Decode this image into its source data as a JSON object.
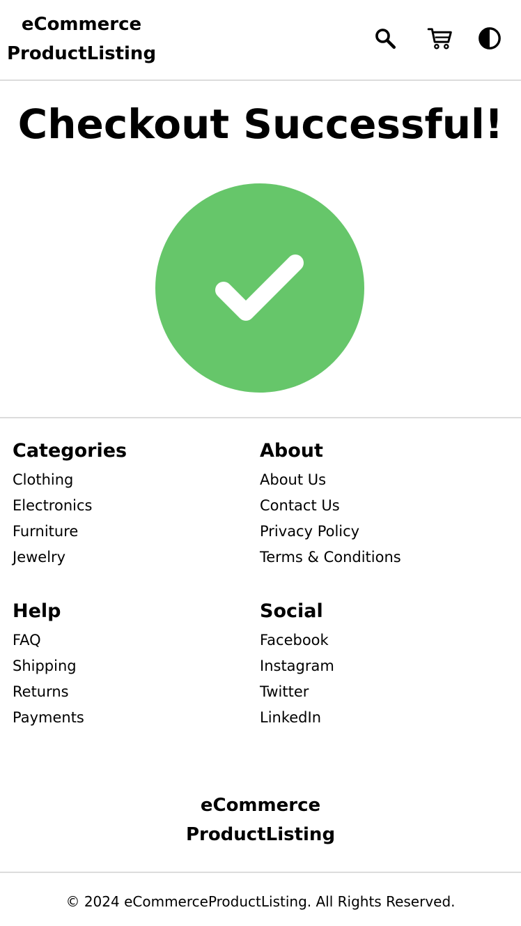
{
  "header": {
    "brand_line1": "eCommerce",
    "brand_line2": "ProductListing",
    "icons": [
      "search-icon",
      "cart-icon",
      "theme-toggle-icon"
    ]
  },
  "main": {
    "title": "Checkout Successful!",
    "success_icon": "checkmark-circle-icon",
    "success_color": "#66c66a"
  },
  "footer": {
    "columns": [
      {
        "heading": "Categories",
        "links": [
          "Clothing",
          "Electronics",
          "Furniture",
          "Jewelry"
        ]
      },
      {
        "heading": "About",
        "links": [
          "About Us",
          "Contact Us",
          "Privacy Policy",
          "Terms & Conditions"
        ]
      },
      {
        "heading": "Help",
        "links": [
          "FAQ",
          "Shipping",
          "Returns",
          "Payments"
        ]
      },
      {
        "heading": "Social",
        "links": [
          "Facebook",
          "Instagram",
          "Twitter",
          "LinkedIn"
        ]
      }
    ],
    "brand_line1": "eCommerce",
    "brand_line2": "ProductListing",
    "copyright": "© 2024 eCommerceProductListing. All Rights Reserved."
  },
  "colors": {
    "divider": "#dcdcdc",
    "text": "#000000",
    "success": "#66c66a"
  }
}
